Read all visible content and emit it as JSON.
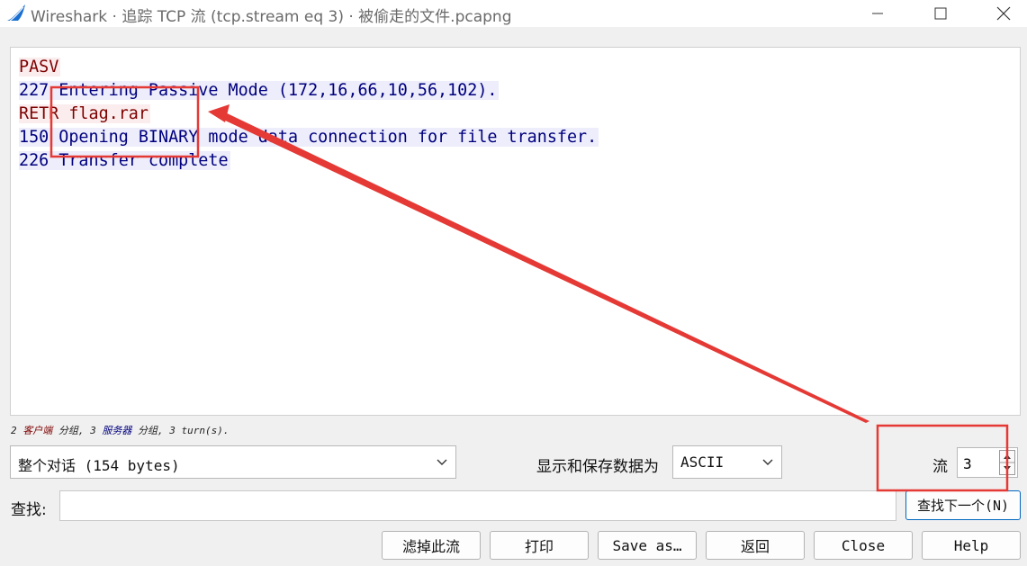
{
  "window": {
    "title": "Wireshark · 追踪 TCP 流 (tcp.stream eq 3) · 被偷走的文件.pcapng"
  },
  "stream": {
    "lines": [
      {
        "text": "PASV",
        "side": "client"
      },
      {
        "text": "227 Entering Passive Mode (172,16,66,10,56,102).",
        "side": "server"
      },
      {
        "text": "RETR flag.rar",
        "side": "client"
      },
      {
        "text": "150 Opening BINARY mode data connection for file transfer.",
        "side": "server"
      },
      {
        "text": "226 Transfer complete",
        "side": "server"
      }
    ]
  },
  "summary": {
    "client_count": "2",
    "client_label": "客户端",
    "text1": " 分组, ",
    "server_count": "3",
    "server_label": "服务器",
    "text2": " 分组, 3 turn(s)."
  },
  "controls": {
    "conversation_select": "整个对话 (154 bytes)",
    "show_as_label": "显示和保存数据为",
    "encoding_select": "ASCII",
    "stream_label": "流",
    "stream_number": "3",
    "find_label": "查找:",
    "find_value": "",
    "find_next_button": "查找下一个(N)"
  },
  "buttons": {
    "filter_out": "滤掉此流",
    "print": "打印",
    "save_as": "Save as…",
    "back": "返回",
    "close": "Close",
    "help": "Help"
  },
  "colors": {
    "client_text": "#7e0000",
    "client_bg": "#fbeded",
    "server_text": "#00007e",
    "server_bg": "#ededfb",
    "annotation": "#e53935"
  }
}
